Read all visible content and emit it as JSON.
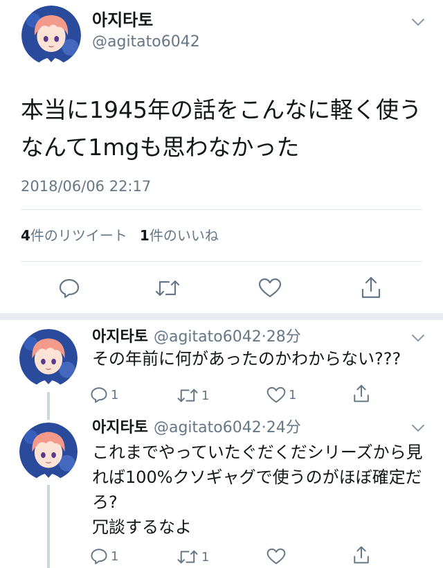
{
  "main_tweet": {
    "display_name": "아지타토",
    "handle": "@agitato6042",
    "text": "本当に1945年の話をこんなに軽く使うなんて1mgも思わなかった",
    "timestamp": "2018/06/06 22:17",
    "retweet_count": "4",
    "retweet_label": "件のリツイート",
    "like_count": "1",
    "like_label": "件のいいね",
    "icons": [
      "reply-icon",
      "retweet-icon",
      "like-icon",
      "share-icon"
    ]
  },
  "replies": [
    {
      "display_name": "아지타토",
      "handle": "@agitato6042",
      "time": "·28分",
      "text": "その年前に何があったのかわからない???",
      "reply_count": "1",
      "retweet_count": "1",
      "like_count": "1"
    },
    {
      "display_name": "아지타토",
      "handle": "@agitato6042",
      "time": "·24分",
      "text": "これまでやっていたぐだくだシリーズから見れば100%クソギャグで使うのがほぼ確定だろ?\n冗談するなよ",
      "reply_count": "1",
      "retweet_count": "1",
      "like_count": ""
    }
  ],
  "colors": {
    "text": "#14171a",
    "secondary": "#657786",
    "divider": "#e1e8ed",
    "thread_line": "#ccd6dd",
    "avatar_bg": "#2a4a9c",
    "avatar_hair": "#f39a8a"
  }
}
